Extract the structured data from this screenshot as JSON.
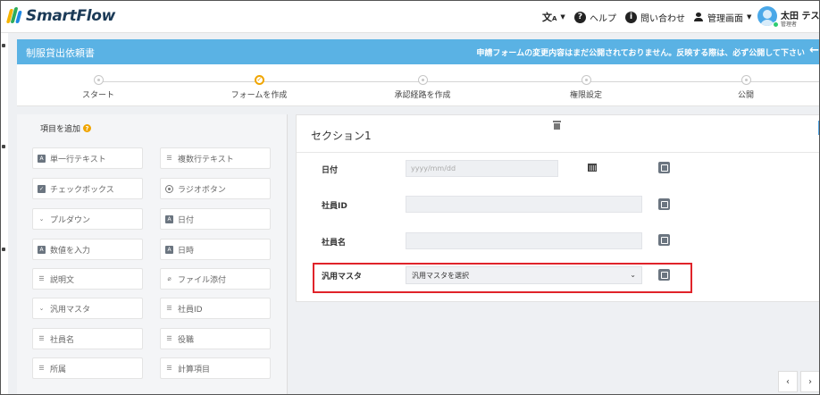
{
  "header": {
    "app_name": "SmartFlow",
    "nav": [
      {
        "label": "",
        "icon": "translate-icon",
        "has_caret": true
      },
      {
        "label": "ヘルプ",
        "icon": "help-icon",
        "has_caret": false
      },
      {
        "label": "問い合わせ",
        "icon": "info-icon",
        "has_caret": false
      },
      {
        "label": "管理画面",
        "icon": "user-icon",
        "has_caret": true
      }
    ],
    "user": {
      "name": "太田 テスト",
      "role": "管理者"
    }
  },
  "banner": {
    "title": "制服貸出依頼書",
    "warning": "申請フォームの変更内容はまだ公開されておりません。反映する際は、必ず公開して下さい",
    "back_icon": "arrow-left-icon"
  },
  "steps": [
    {
      "label": "スタート",
      "active": false
    },
    {
      "label": "フォームを作成",
      "active": true
    },
    {
      "label": "承認経路を作成",
      "active": false
    },
    {
      "label": "権限設定",
      "active": false
    },
    {
      "label": "公開",
      "active": false
    }
  ],
  "palette": {
    "title": "項目を追加",
    "items": [
      {
        "label": "単一行テキスト",
        "icon": "text-box-icon"
      },
      {
        "label": "複数行テキスト",
        "icon": "lines-icon"
      },
      {
        "label": "チェックボックス",
        "icon": "checkbox-icon"
      },
      {
        "label": "ラジオボタン",
        "icon": "radio-icon"
      },
      {
        "label": "プルダウン",
        "icon": "chevron-down-icon"
      },
      {
        "label": "日付",
        "icon": "text-box-icon"
      },
      {
        "label": "数値を入力",
        "icon": "text-box-icon"
      },
      {
        "label": "日時",
        "icon": "text-box-icon"
      },
      {
        "label": "説明文",
        "icon": "lines-icon"
      },
      {
        "label": "ファイル添付",
        "icon": "paperclip-icon"
      },
      {
        "label": "汎用マスタ",
        "icon": "chevron-down-icon"
      },
      {
        "label": "社員ID",
        "icon": "lines-icon"
      },
      {
        "label": "社員名",
        "icon": "lines-icon"
      },
      {
        "label": "役職",
        "icon": "lines-icon"
      },
      {
        "label": "所属",
        "icon": "lines-icon"
      },
      {
        "label": "計算項目",
        "icon": "lines-icon"
      }
    ]
  },
  "form": {
    "section_title": "セクション1",
    "fields": [
      {
        "label": "日付",
        "type": "date",
        "placeholder": "yyyy/mm/dd",
        "value": ""
      },
      {
        "label": "社員ID",
        "type": "text",
        "placeholder": "",
        "value": ""
      },
      {
        "label": "社員名",
        "type": "text",
        "placeholder": "",
        "value": ""
      },
      {
        "label": "汎用マスタ",
        "type": "select",
        "placeholder": "",
        "value": "汎用マスタを選択"
      }
    ]
  },
  "pager": {
    "prev": "‹",
    "next": "›"
  },
  "colors": {
    "brand_blue": "#5ab2e4",
    "accent_orange": "#f0a500",
    "highlight_red": "#e0232a"
  }
}
